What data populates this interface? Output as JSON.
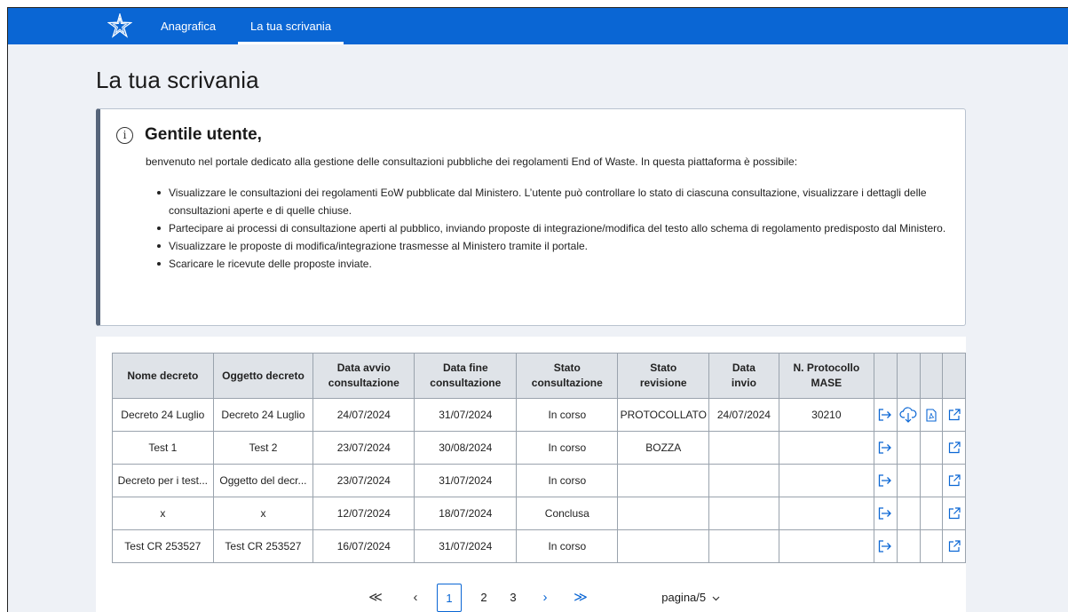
{
  "nav": {
    "items": [
      {
        "label": "Anagrafica"
      },
      {
        "label": "La tua scrivania"
      }
    ]
  },
  "page": {
    "title": "La tua scrivania"
  },
  "info": {
    "title": "Gentile utente,",
    "intro": "benvenuto nel portale dedicato alla gestione delle consultazioni pubbliche dei regolamenti End of Waste. In questa piattaforma è possibile:",
    "bullets": [
      "Visualizzare le consultazioni dei regolamenti EoW pubblicate dal Ministero. L’utente può controllare lo stato di ciascuna consultazione, visualizzare i dettagli delle consultazioni aperte e di quelle chiuse.",
      "Partecipare ai processi di consultazione aperti al pubblico, inviando proposte di integrazione/modifica del testo allo schema di regolamento predisposto dal Ministero.",
      "Visualizzare le proposte di modifica/integrazione trasmesse al Ministero tramite il portale.",
      "Scaricare le ricevute delle proposte inviate."
    ]
  },
  "table": {
    "headers": [
      "Nome decreto",
      "Oggetto decreto",
      "Data avvio consultazione",
      "Data fine consultazione",
      "Stato consultazione",
      "Stato revisione",
      "Data invio",
      "N. Protocollo MASE"
    ],
    "rows": [
      {
        "cells": [
          "Decreto 24 Luglio",
          "Decreto 24 Luglio",
          "24/07/2024",
          "31/07/2024",
          "In corso",
          "PROTOCOLLATO",
          "24/07/2024",
          "30210"
        ],
        "icons": [
          "exit-icon",
          "cloud-download-icon",
          "pdf-icon",
          "open-external-icon"
        ]
      },
      {
        "cells": [
          "Test 1",
          "Test 2",
          "23/07/2024",
          "30/08/2024",
          "In corso",
          "BOZZA",
          "",
          ""
        ],
        "icons": [
          "exit-icon",
          "",
          "",
          "open-external-icon"
        ]
      },
      {
        "cells": [
          "Decreto per i test...",
          "Oggetto del decr...",
          "23/07/2024",
          "31/07/2024",
          "In corso",
          "",
          "",
          ""
        ],
        "icons": [
          "exit-icon",
          "",
          "",
          "open-external-icon"
        ]
      },
      {
        "cells": [
          "x",
          "x",
          "12/07/2024",
          "18/07/2024",
          "Conclusa",
          "",
          "",
          ""
        ],
        "icons": [
          "exit-icon",
          "",
          "",
          "open-external-icon"
        ]
      },
      {
        "cells": [
          "Test CR 253527",
          "Test CR 253527",
          "16/07/2024",
          "31/07/2024",
          "In corso",
          "",
          "",
          ""
        ],
        "icons": [
          "exit-icon",
          "",
          "",
          "open-external-icon"
        ]
      }
    ]
  },
  "pagination": {
    "first": "≪",
    "prev": "‹",
    "pages": [
      "1",
      "2",
      "3"
    ],
    "current": "1",
    "next": "›",
    "last": "≫",
    "page_select": "pagina/5"
  },
  "colors": {
    "nav_bg": "#0a66d4",
    "accent": "#0a66d4",
    "card_border_left": "#56657a"
  }
}
